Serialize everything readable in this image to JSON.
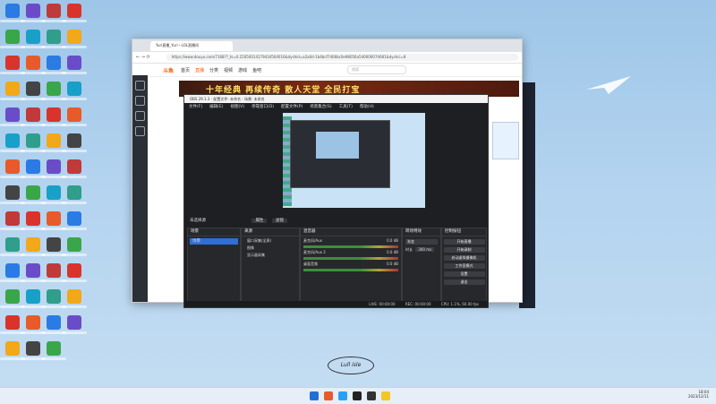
{
  "browser": {
    "tab_title": "Yuri直播_Yuri丶LOL直播间",
    "url": "https://www.douyu.com/7168??_ts=0.25050014179434564016&dyshid=a2a0d-1b4bcf7406bc0e98056a540000074681&dyshci=8",
    "site_logo": "斗鱼",
    "nav_items": [
      "首页",
      "直播",
      "分类",
      "视频",
      "游戏",
      "鱼吧"
    ],
    "search_placeholder": "搜索",
    "banner_text": "十年经典 再续传奇 散人天堂 全民打宝"
  },
  "obs": {
    "title": "OBS 29.1.3 - 配置文件: 未命名 - 场景: 未命名",
    "menu": [
      "文件(F)",
      "编辑(E)",
      "视图(V)",
      "停靠窗口(D)",
      "配置文件(P)",
      "场景集合(S)",
      "工具(T)",
      "帮助(H)"
    ],
    "source_none_label": "未选择源",
    "props_label": "属性",
    "filters_label": "滤镜",
    "docks": {
      "scenes": {
        "title": "场景",
        "items": [
          "场景"
        ]
      },
      "sources": {
        "title": "来源",
        "items": [
          "窗口采集(全屏)",
          "图像",
          "显示器采集"
        ]
      },
      "mixer": {
        "title": "混音器",
        "tracks": [
          {
            "name": "麦克风/Aux",
            "db": "0.0 dB"
          },
          {
            "name": "麦克风/Aux 2",
            "db": "0.0 dB"
          },
          {
            "name": "桌面音频",
            "db": "0.0 dB"
          }
        ]
      },
      "transitions": {
        "title": "转场特效",
        "type": "渐变",
        "duration_label": "时长",
        "duration": "300 ms"
      },
      "controls": {
        "title": "控制按钮",
        "buttons": [
          "开始直播",
          "开始录制",
          "启动虚拟摄像机",
          "工作室模式",
          "设置",
          "退出"
        ]
      }
    },
    "status": {
      "live": "LIVE: 00:00:00",
      "rec": "REC: 00:00:00",
      "cpu": "CPU: 1.1%, 60.00 fps"
    }
  },
  "desktop": {
    "signature": "Lull isle"
  },
  "taskbar": {
    "time": "18:04",
    "date": "2023/12/11"
  },
  "colors": {
    "obs_bg": "#1e1f22",
    "dock_bg": "#27282c",
    "accent": "#ff5a00",
    "desktop": "#b3d3ef"
  }
}
